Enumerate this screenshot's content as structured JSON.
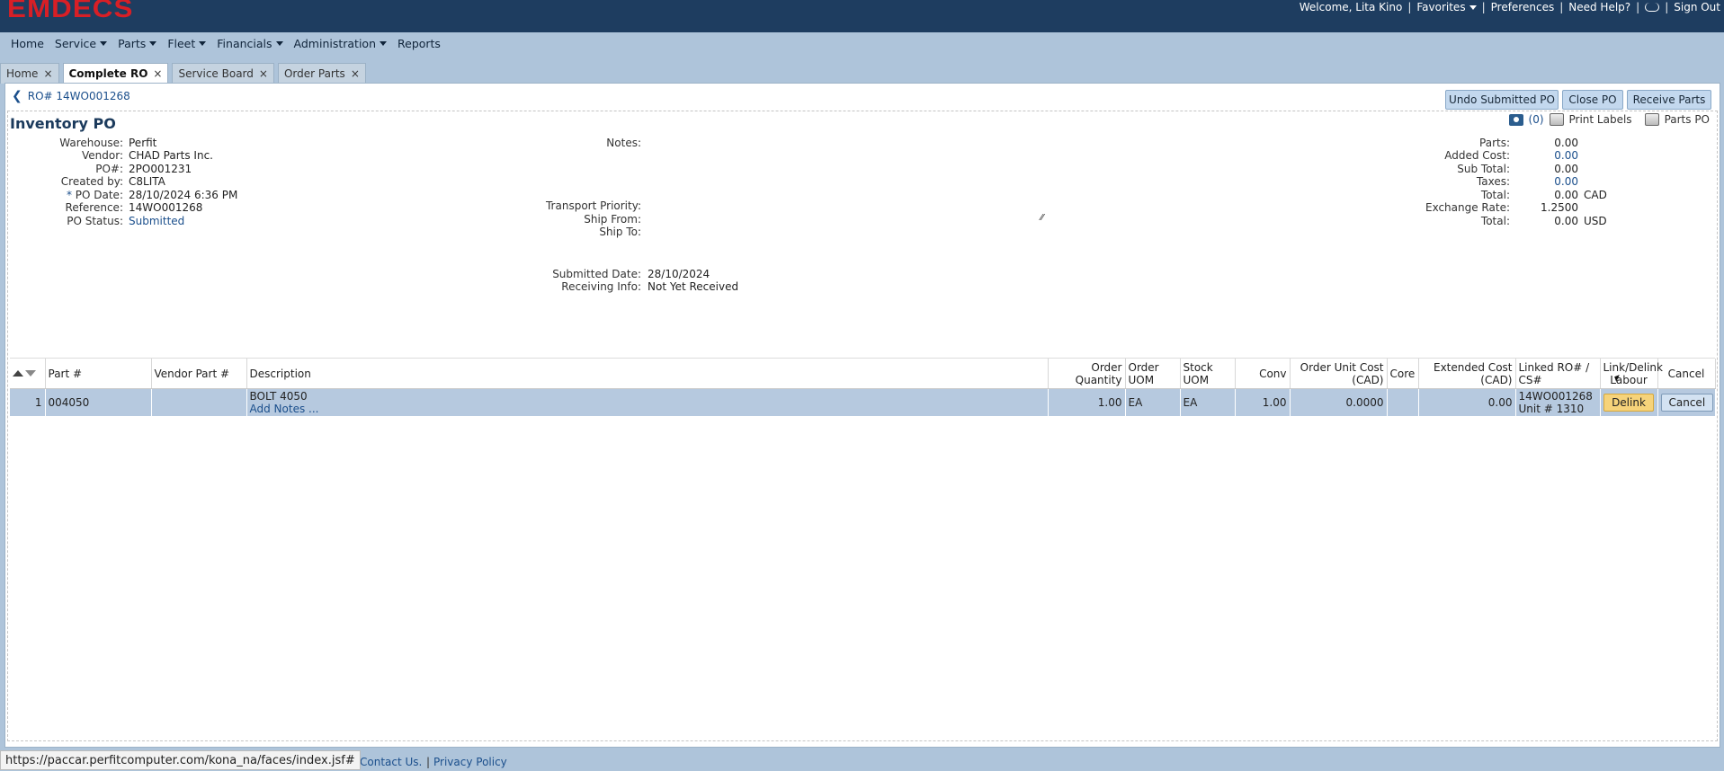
{
  "app": {
    "logo": "EMDECS"
  },
  "top_right": {
    "welcome": "Welcome, Lita Kino",
    "favorites": "Favorites",
    "preferences": "Preferences",
    "help": "Need Help?",
    "sign_out": "Sign Out"
  },
  "menu": [
    "Home",
    "Service",
    "Parts",
    "Fleet",
    "Financials",
    "Administration",
    "Reports"
  ],
  "tabs": [
    {
      "label": "Home"
    },
    {
      "label": "Complete RO"
    },
    {
      "label": "Service Board"
    },
    {
      "label": "Order Parts"
    }
  ],
  "breadcrumb": "RO# 14WO001268",
  "actions": {
    "undo": "Undo Submitted PO",
    "close": "Close PO",
    "receive": "Receive Parts"
  },
  "panel": {
    "title": "Inventory PO",
    "photo_count": "(0)",
    "print_labels": "Print Labels",
    "parts_po": "Parts PO"
  },
  "left_fields": [
    {
      "label": "Warehouse:",
      "value": "Perfit"
    },
    {
      "label": "Vendor:",
      "value": "CHAD Parts Inc."
    },
    {
      "label": "PO#:",
      "value": "2PO001231"
    },
    {
      "label": "Created by:",
      "value": "C8LITA"
    },
    {
      "label": "PO Date:",
      "value": "28/10/2024 6:36 PM",
      "required_mark": "*"
    },
    {
      "label": "Reference:",
      "value": "14WO001268"
    },
    {
      "label": "PO Status:",
      "value": "Submitted"
    }
  ],
  "middle_fields": {
    "notes_label": "Notes:",
    "transport_priority": "Transport Priority:",
    "ship_from": "Ship From:",
    "ship_to": "Ship To:",
    "submitted_date_label": "Submitted Date:",
    "submitted_date": "28/10/2024",
    "receiving_info_label": "Receiving Info:",
    "receiving_info": "Not Yet Received"
  },
  "totals": [
    {
      "label": "Parts:",
      "value": "0.00",
      "unit": ""
    },
    {
      "label": "Added Cost:",
      "value": "0.00",
      "unit": ""
    },
    {
      "label": "Sub Total:",
      "value": "0.00",
      "unit": ""
    },
    {
      "label": "Taxes:",
      "value": "0.00",
      "unit": ""
    },
    {
      "label": "Total:",
      "value": "0.00",
      "unit": "CAD"
    },
    {
      "label": "Exchange Rate:",
      "value": "1.2500",
      "unit": ""
    },
    {
      "label": "Total:",
      "value": "0.00",
      "unit": "USD"
    }
  ],
  "grid": {
    "headers": {
      "part": "Part #",
      "vendor_part": "Vendor Part #",
      "description": "Description",
      "order_qty_1": "Order",
      "order_qty_2": "Quantity",
      "order_uom_1": "Order",
      "order_uom_2": "UOM",
      "stock_uom_1": "Stock",
      "stock_uom_2": "UOM",
      "conv": "Conv",
      "unit_cost_1": "Order Unit Cost",
      "unit_cost_2": "(CAD)",
      "core": "Core",
      "ext_cost_1": "Extended Cost",
      "ext_cost_2": "(CAD)",
      "linked_1": "Linked RO# /",
      "linked_2": "CS#",
      "link_1": "Link/Delink",
      "link_2": "Labour",
      "cancel": "Cancel"
    },
    "rows": [
      {
        "num": "1",
        "part": "004050",
        "vendor_part": "",
        "description": "BOLT 4050",
        "notes_link": "Add Notes ...",
        "order_qty": "1.00",
        "order_uom": "EA",
        "stock_uom": "EA",
        "conv": "1.00",
        "unit_cost": "0.0000",
        "core": "",
        "ext_cost": "0.00",
        "linked_ro": "14WO001268",
        "unit": "Unit #  1310",
        "delink": "Delink",
        "cancel": "Cancel"
      }
    ]
  },
  "status_url": "https://paccar.perfitcomputer.com/kona_na/faces/index.jsf#",
  "footer": {
    "contact": "Contact Us.",
    "privacy": "Privacy Policy"
  }
}
